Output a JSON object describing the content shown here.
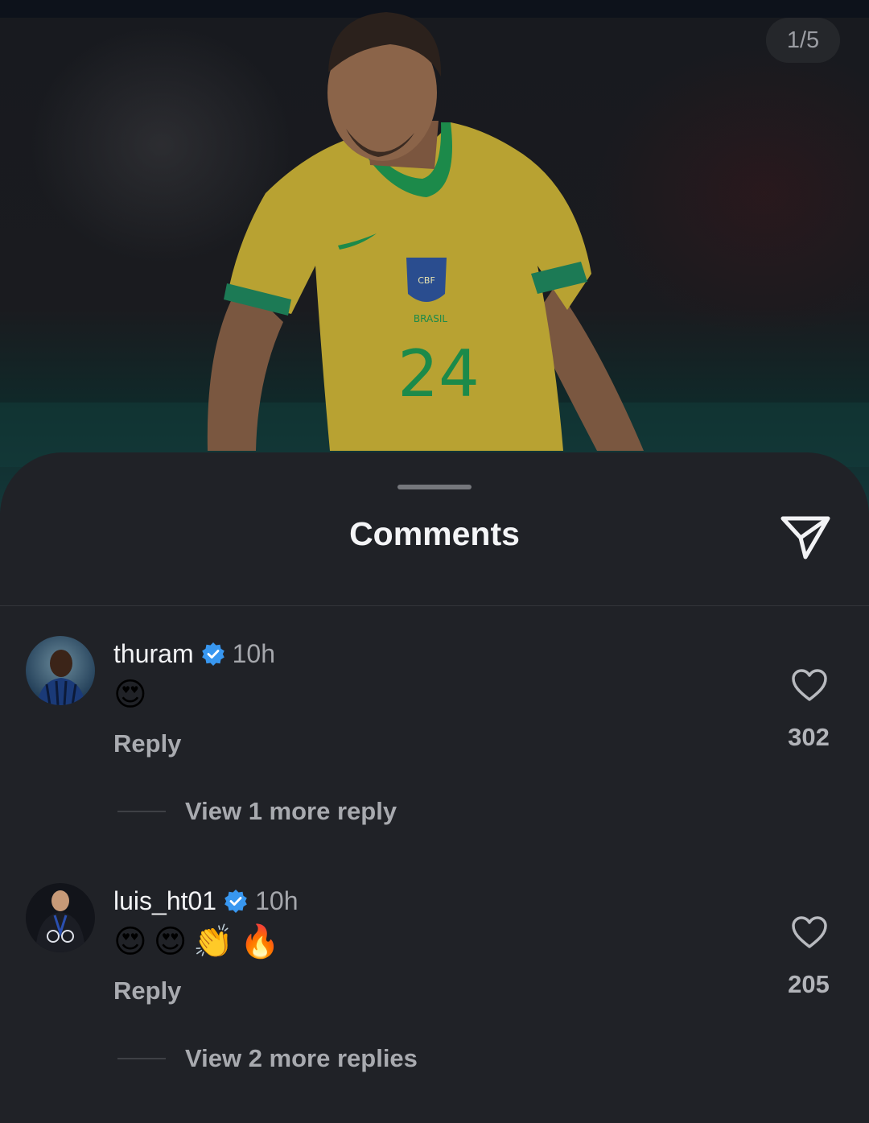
{
  "photo": {
    "counter": "1/5",
    "jersey_text": "BRASIL",
    "jersey_number": "24",
    "badge_text": "CBF"
  },
  "sheet": {
    "title": "Comments",
    "share_icon": "paper-plane-icon"
  },
  "comments": [
    {
      "username": "thuram",
      "verified": true,
      "time": "10h",
      "text": "😍",
      "reply_label": "Reply",
      "likes": "302",
      "view_replies": "View 1 more reply"
    },
    {
      "username": "luis_ht01",
      "verified": true,
      "time": "10h",
      "text": [
        "😍",
        "😍",
        "👏",
        "🔥"
      ],
      "reply_label": "Reply",
      "likes": "205",
      "view_replies": "View 2 more replies"
    }
  ],
  "colors": {
    "sheet_bg": "#202227",
    "verified_blue": "#3897f0",
    "jersey_yellow": "#cfb537",
    "jersey_green": "#1c8a4a"
  }
}
